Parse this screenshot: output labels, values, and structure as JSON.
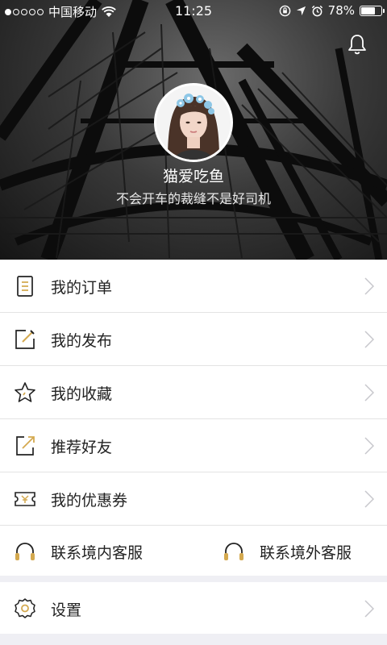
{
  "status_bar": {
    "carrier": "中国移动",
    "time": "11:25",
    "battery": "78%",
    "battery_level": 0.78,
    "signal_dots_filled": 1,
    "signal_dots_total": 5
  },
  "profile": {
    "username": "猫爱吃鱼",
    "bio": "不会开车的裁缝不是好司机"
  },
  "menu": {
    "items": [
      {
        "label": "我的订单",
        "icon": "order-list-icon"
      },
      {
        "label": "我的发布",
        "icon": "edit-post-icon"
      },
      {
        "label": "我的收藏",
        "icon": "star-icon"
      },
      {
        "label": "推荐好友",
        "icon": "share-arrow-icon"
      },
      {
        "label": "我的优惠券",
        "icon": "coupon-icon"
      }
    ],
    "services": [
      {
        "label": "联系境内客服",
        "icon": "headset-icon"
      },
      {
        "label": "联系境外客服",
        "icon": "headset-icon"
      }
    ],
    "settings": {
      "label": "设置",
      "icon": "gear-icon"
    }
  },
  "colors": {
    "accent_gold": "#d4a94f",
    "icon_dark": "#222222",
    "chevron": "#c7c7cc",
    "background": "#efeff4"
  }
}
